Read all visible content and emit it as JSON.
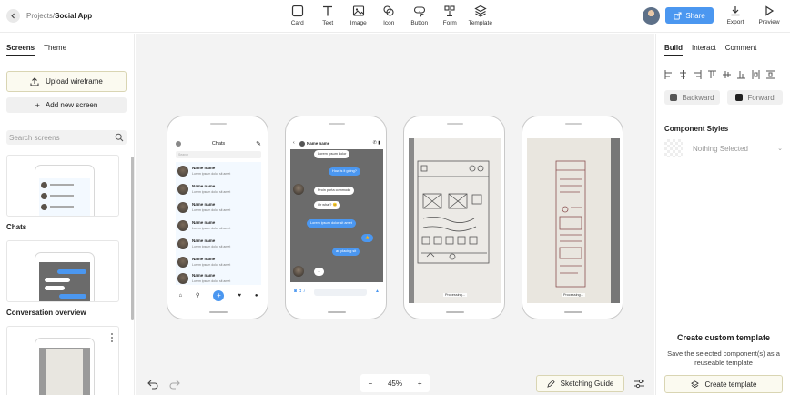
{
  "header": {
    "breadcrumb_parent": "Projects",
    "breadcrumb_separator": "/",
    "breadcrumb_current": "Social App",
    "tools": [
      {
        "label": "Card",
        "icon": "card-icon"
      },
      {
        "label": "Text",
        "icon": "text-icon"
      },
      {
        "label": "Image",
        "icon": "image-icon"
      },
      {
        "label": "Icon",
        "icon": "icon-icon"
      },
      {
        "label": "Button",
        "icon": "button-icon"
      },
      {
        "label": "Form",
        "icon": "form-icon"
      },
      {
        "label": "Template",
        "icon": "template-icon"
      }
    ],
    "share_label": "Share",
    "export_label": "Export",
    "preview_label": "Preview",
    "accent_color": "#4b97f0"
  },
  "left_panel": {
    "tabs": [
      "Screens",
      "Theme"
    ],
    "active_tab": "Screens",
    "upload_label": "Upload wireframe",
    "add_screen_label": "Add new screen",
    "search_placeholder": "Search screens",
    "screens": [
      {
        "name": "Chats"
      },
      {
        "name": "Conversation overview"
      },
      {
        "name": ""
      }
    ]
  },
  "canvas": {
    "chat_list": {
      "title": "Chats",
      "search_hint": "Search",
      "items": [
        {
          "name": "Name name",
          "preview": "Lorem ipsum dolor sit amet"
        },
        {
          "name": "Name name",
          "preview": "Lorem ipsum dolor sit amet"
        },
        {
          "name": "Name name",
          "preview": "Lorem ipsum dolor sit amet"
        },
        {
          "name": "Name name",
          "preview": "Lorem ipsum dolor sit amet"
        },
        {
          "name": "Name name",
          "preview": "Lorem ipsum dolor sit amet"
        },
        {
          "name": "Name name",
          "preview": "Lorem ipsum dolor sit amet"
        },
        {
          "name": "Name name",
          "preview": "Lorem ipsum dolor sit amet"
        }
      ]
    },
    "conversation": {
      "contact_name": "Name name",
      "messages": [
        {
          "dir": "in",
          "text": "Lorem ipsum dolor"
        },
        {
          "dir": "out",
          "text": "How is it going?"
        },
        {
          "dir": "in",
          "text": "Proin porta commodo"
        },
        {
          "dir": "in",
          "text": "Or what? 😊"
        },
        {
          "dir": "out",
          "text": "Lorem ipsum dolor sit amet"
        },
        {
          "dir": "out",
          "text": "👍"
        },
        {
          "dir": "out",
          "text": "ad placing sit"
        },
        {
          "dir": "in",
          "text": "..."
        }
      ]
    },
    "sketches": [
      {
        "caption": "Processing..."
      },
      {
        "caption": "Processing..."
      }
    ],
    "zoom_level": "45%",
    "zoom_minus": "−",
    "zoom_plus": "+",
    "sketching_guide_label": "Sketching Guide"
  },
  "right_panel": {
    "tabs": [
      "Build",
      "Interact",
      "Comment"
    ],
    "active_tab": "Build",
    "backward_label": "Backward",
    "forward_label": "Forward",
    "component_styles_title": "Component Styles",
    "style_select_value": "Nothing Selected",
    "custom_template_title": "Create custom template",
    "custom_template_desc": "Save the selected component(s) as a reuseable template",
    "create_template_label": "Create template"
  }
}
